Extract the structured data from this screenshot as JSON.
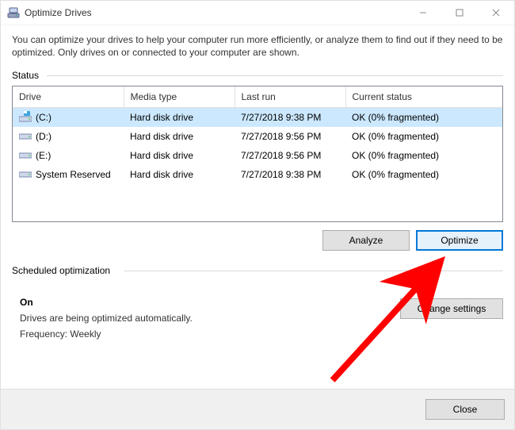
{
  "title": "Optimize Drives",
  "intro": "You can optimize your drives to help your computer run more efficiently, or analyze them to find out if they need to be optimized. Only drives on or connected to your computer are shown.",
  "status_label": "Status",
  "columns": {
    "drive": "Drive",
    "media": "Media type",
    "lastrun": "Last run",
    "status": "Current status"
  },
  "rows": [
    {
      "drive": "(C:)",
      "icon": "c",
      "media": "Hard disk drive",
      "lastrun": "7/27/2018 9:38 PM",
      "status": "OK (0% fragmented)"
    },
    {
      "drive": "(D:)",
      "icon": "d",
      "media": "Hard disk drive",
      "lastrun": "7/27/2018 9:56 PM",
      "status": "OK (0% fragmented)"
    },
    {
      "drive": "(E:)",
      "icon": "d",
      "media": "Hard disk drive",
      "lastrun": "7/27/2018 9:56 PM",
      "status": "OK (0% fragmented)"
    },
    {
      "drive": "System Reserved",
      "icon": "d",
      "media": "Hard disk drive",
      "lastrun": "7/27/2018 9:38 PM",
      "status": "OK (0% fragmented)"
    }
  ],
  "buttons": {
    "analyze": "Analyze",
    "optimize": "Optimize",
    "change": "Change settings",
    "close": "Close"
  },
  "sched": {
    "label": "Scheduled optimization",
    "state": "On",
    "desc": "Drives are being optimized automatically.",
    "freq": "Frequency: Weekly"
  },
  "annotation": {
    "arrow_color": "#ff0000"
  }
}
